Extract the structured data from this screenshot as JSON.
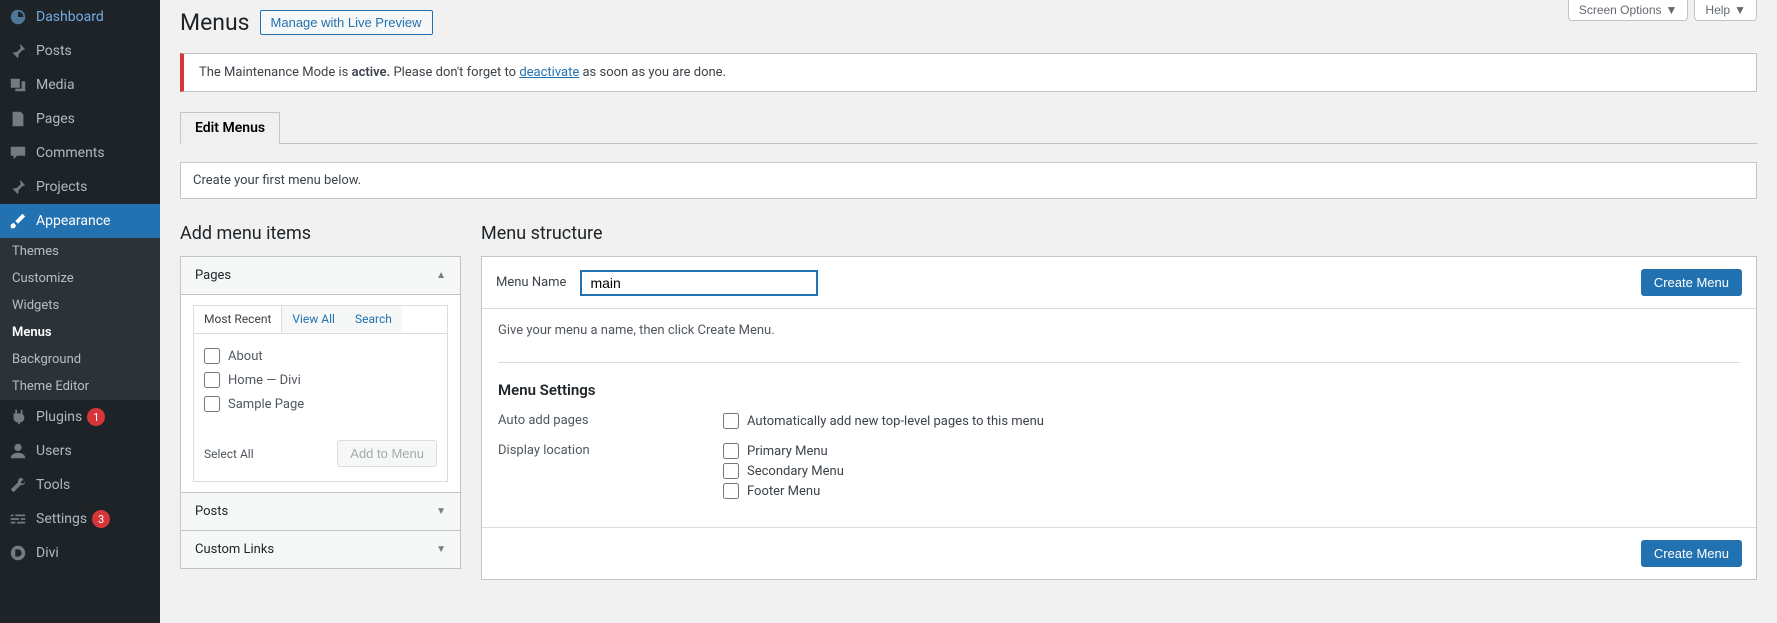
{
  "top_buttons": {
    "screen_options": "Screen Options",
    "help": "Help"
  },
  "sidebar": {
    "items": [
      {
        "label": "Dashboard",
        "icon": "dashboard"
      },
      {
        "label": "Posts",
        "icon": "pin"
      },
      {
        "label": "Media",
        "icon": "media"
      },
      {
        "label": "Pages",
        "icon": "page"
      },
      {
        "label": "Comments",
        "icon": "comment"
      },
      {
        "label": "Projects",
        "icon": "pin"
      },
      {
        "label": "Appearance",
        "icon": "brush",
        "active": true
      },
      {
        "label": "Plugins",
        "icon": "plug",
        "badge": "1"
      },
      {
        "label": "Users",
        "icon": "user"
      },
      {
        "label": "Tools",
        "icon": "wrench"
      },
      {
        "label": "Settings",
        "icon": "sliders",
        "badge": "3"
      },
      {
        "label": "Divi",
        "icon": "divi"
      }
    ],
    "submenu": [
      {
        "label": "Themes"
      },
      {
        "label": "Customize"
      },
      {
        "label": "Widgets"
      },
      {
        "label": "Menus",
        "current": true
      },
      {
        "label": "Background"
      },
      {
        "label": "Theme Editor"
      }
    ]
  },
  "page": {
    "title": "Menus",
    "live_preview_btn": "Manage with Live Preview"
  },
  "notice": {
    "prefix": "The Maintenance Mode is ",
    "bold": "active.",
    "mid": " Please don't forget to ",
    "link": "deactivate",
    "suffix": " as soon as you are done."
  },
  "tabs": {
    "edit_menus": "Edit Menus"
  },
  "info": {
    "first_menu": "Create your first menu below."
  },
  "left_col": {
    "title": "Add menu items",
    "accordion": {
      "pages": "Pages",
      "posts": "Posts",
      "custom_links": "Custom Links"
    },
    "subtabs": {
      "recent": "Most Recent",
      "view_all": "View All",
      "search": "Search"
    },
    "page_items": [
      "About",
      "Home — Divi",
      "Sample Page"
    ],
    "select_all": "Select All",
    "add_to_menu": "Add to Menu"
  },
  "right_col": {
    "title": "Menu structure",
    "menu_name_label": "Menu Name",
    "menu_name_value": "main",
    "create_menu_btn": "Create Menu",
    "hint": "Give your menu a name, then click Create Menu.",
    "settings_title": "Menu Settings",
    "auto_add_label": "Auto add pages",
    "auto_add_option": "Automatically add new top-level pages to this menu",
    "display_location_label": "Display location",
    "locations": [
      "Primary Menu",
      "Secondary Menu",
      "Footer Menu"
    ]
  }
}
